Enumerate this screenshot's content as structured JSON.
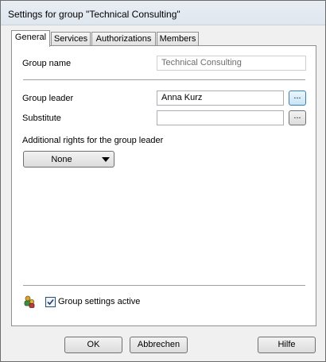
{
  "window": {
    "title": "Settings for group \"Technical Consulting\""
  },
  "tabs": [
    {
      "label": "General",
      "active": true
    },
    {
      "label": "Services"
    },
    {
      "label": "Authorizations"
    },
    {
      "label": "Members"
    }
  ],
  "general": {
    "group_name_label": "Group name",
    "group_name_value": "Technical Consulting",
    "group_leader_label": "Group leader",
    "group_leader_value": "Anna Kurz",
    "substitute_label": "Substitute",
    "substitute_value": "",
    "browse_label": "...",
    "additional_rights_label": "Additional rights for the group leader",
    "additional_rights_value": "None",
    "group_settings_active_label": "Group settings active",
    "group_settings_active_checked": true
  },
  "footer": {
    "ok_label": "OK",
    "cancel_label": "Abbrechen",
    "help_label": "Hilfe"
  },
  "icons": {
    "dropdown": "chevron-down-icon",
    "group": "group-icon",
    "check": "checkmark-icon"
  },
  "colors": {
    "panel_bg": "#ffffff",
    "dialog_bg": "#f0f0f0",
    "focus_button": "#3c7fb1"
  }
}
